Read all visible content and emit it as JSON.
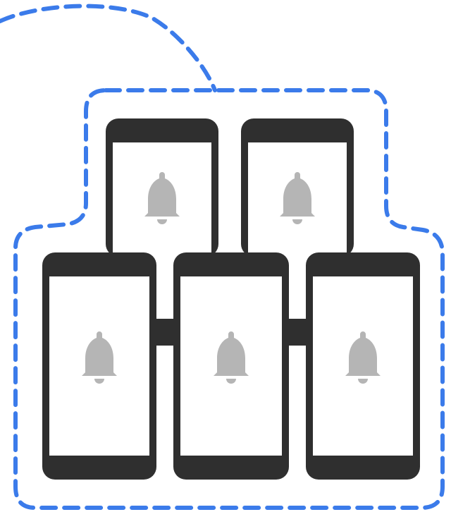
{
  "diagram": {
    "outline_color": "#3b7bea",
    "device_color": "#2f2f2f",
    "screen_color": "#ffffff",
    "icon_color": "#b5b5b5",
    "devices": [
      {
        "name": "phone-top-left",
        "icon": "bell-icon"
      },
      {
        "name": "phone-top-right",
        "icon": "bell-icon"
      },
      {
        "name": "phone-bottom-left",
        "icon": "bell-icon"
      },
      {
        "name": "phone-bottom-center",
        "icon": "bell-icon"
      },
      {
        "name": "phone-bottom-right",
        "icon": "bell-icon"
      }
    ],
    "connectors": [
      {
        "name": "connector-left-center"
      },
      {
        "name": "connector-center-right"
      }
    ]
  }
}
